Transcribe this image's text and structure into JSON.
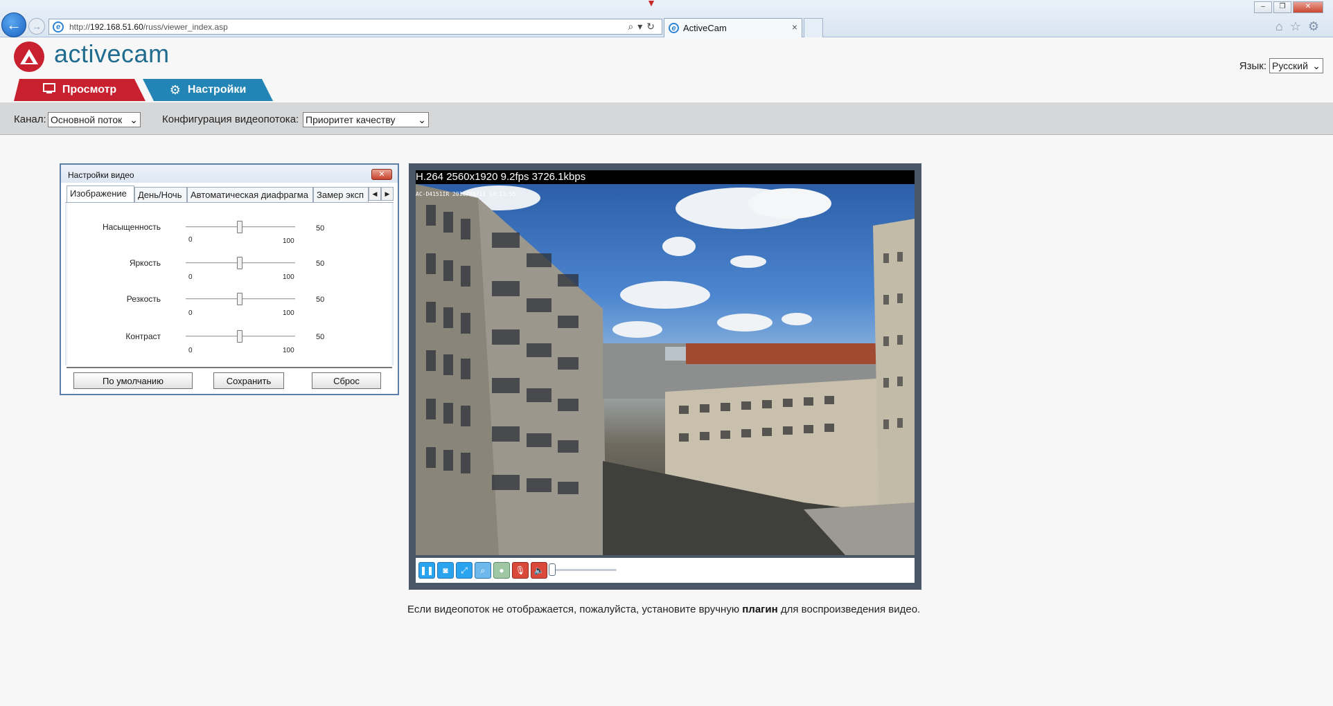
{
  "browser": {
    "url_prefix": "http://",
    "url_host": "192.168.51.60",
    "url_path": "/russ/viewer_index.asp",
    "tab_title": "ActiveCam",
    "tab_close": "×",
    "tools": "⌕▾↻",
    "icons": "⌂☆⚙",
    "win_minimize": "–",
    "win_restore": "❐",
    "win_close": "✕",
    "back_arrow": "←",
    "forward_arrow": "→"
  },
  "header": {
    "logo_text": "activecam",
    "language_label": "Язык:",
    "language_value": "Русский"
  },
  "tabs": [
    {
      "label": "Просмотр",
      "icon": "monitor-icon",
      "color": "#c8202f"
    },
    {
      "label": "Настройки",
      "icon": "gear-icon",
      "color": "#2385b5"
    }
  ],
  "toolbar": {
    "channel_label": "Канал:",
    "channel_value": "Основной поток",
    "stream_config_label": "Конфигурация видеопотока:",
    "stream_config_value": "Приоритет качеству"
  },
  "video_settings": {
    "title": "Настройки видео",
    "tabs": [
      "Изображение",
      "День/Ночь",
      "Автоматическая диафрагма",
      "Замер эксп"
    ],
    "sliders": [
      {
        "label": "Насыщенность",
        "min": "0",
        "max": "100",
        "value": "50"
      },
      {
        "label": "Яркость",
        "min": "0",
        "max": "100",
        "value": "50"
      },
      {
        "label": "Резкость",
        "min": "0",
        "max": "100",
        "value": "50"
      },
      {
        "label": "Контраст",
        "min": "0",
        "max": "100",
        "value": "50"
      }
    ],
    "buttons": {
      "default": "По умолчанию",
      "save": "Сохранить",
      "reset": "Сброс"
    }
  },
  "video": {
    "info": "H.264 2560x1920 9.2fps 3726.1kbps",
    "camera_stamp": "AC-D4151IR  2016/08/11 14:13:55",
    "controls": [
      "pause-icon",
      "snapshot-icon",
      "fullscreen-icon",
      "zoom-icon",
      "record-icon",
      "microphone-icon",
      "speaker-icon"
    ]
  },
  "notice": {
    "before": "Если видеопоток не отображается, пожалуйста, установите вручную ",
    "link": "плагин",
    "after": " для воспроизведения видео."
  }
}
